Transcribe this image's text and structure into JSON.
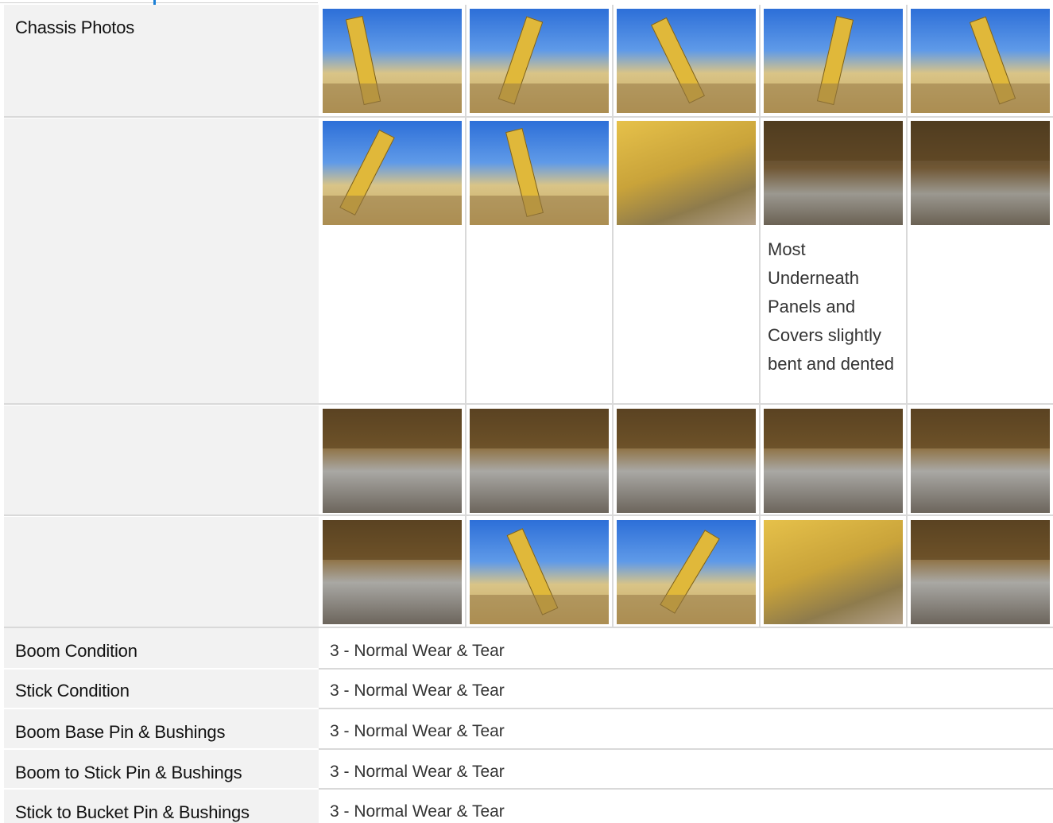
{
  "sections": {
    "chassis_label": "Chassis Photos",
    "photo_caption": "Most Underneath Panels and Covers slightly bent and dented"
  },
  "photo_icons": [
    "excavator-photo",
    "bucket-photo",
    "boom-photo",
    "arm-photo",
    "boom-photo",
    "boom-photo",
    "boom-photo",
    "frame-photo",
    "underside-photo",
    "underside-photo",
    "undercarriage-photo",
    "undercarriage-photo",
    "undercarriage-photo",
    "undercarriage-photo",
    "swing-bearing-photo",
    "undercarriage-photo",
    "boom-photo",
    "boom-photo",
    "boom-base-photo",
    "undercarriage-photo"
  ],
  "conditions": [
    {
      "label": "Boom Condition",
      "value": "3 - Normal Wear & Tear"
    },
    {
      "label": "Stick Condition",
      "value": "3 - Normal Wear & Tear"
    },
    {
      "label": "Boom Base Pin & Bushings",
      "value": "3 - Normal Wear & Tear"
    },
    {
      "label": "Boom to Stick Pin & Bushings",
      "value": "3 - Normal Wear & Tear"
    },
    {
      "label": "Stick to Bucket Pin & Bushings",
      "value": "3 - Normal Wear & Tear"
    }
  ],
  "colors": {
    "label_bg": "#f2f2f2",
    "grid_line": "#d9d9d9",
    "accent": "#1a7fd6"
  }
}
